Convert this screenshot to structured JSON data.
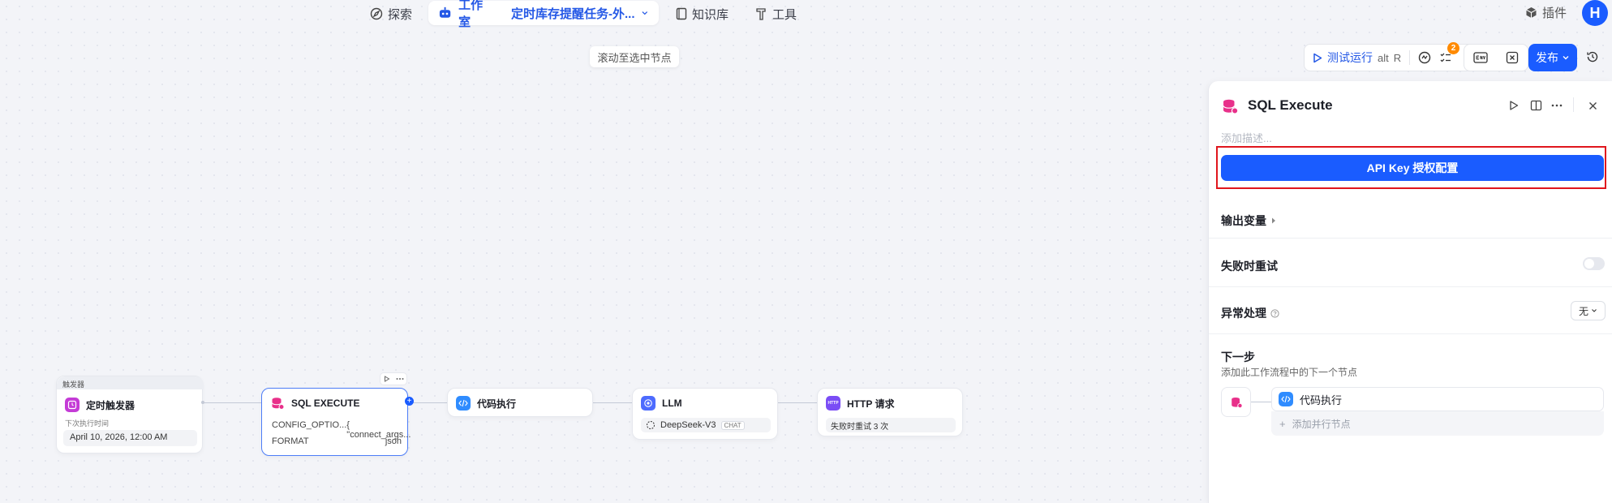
{
  "nav": {
    "explore": "探索",
    "studio": "工作室",
    "workflow_name": "定时库存提醒任务-外...",
    "knowledge": "知识库",
    "tools": "工具",
    "plugins": "插件",
    "avatar": "H"
  },
  "canvas": {
    "scroll_hint": "滚动至选中节点"
  },
  "toolbar": {
    "test_run": "测试运行",
    "shortcut_alt": "alt",
    "shortcut_key": "R",
    "badge_count": "2",
    "publish": "发布"
  },
  "nodes": {
    "trigger_group_label": "触发器",
    "trigger_title": "定时触发器",
    "trigger_next_label": "下次执行时间",
    "trigger_next_value": "April 10, 2026, 12:00 AM",
    "sql_title": "SQL EXECUTE",
    "sql_row1_key": "CONFIG_OPTIO...",
    "sql_row1_val": "{ \"connect_args...",
    "sql_row2_key": "FORMAT",
    "sql_row2_val": "json",
    "code_title": "代码执行",
    "llm_title": "LLM",
    "llm_model": "DeepSeek-V3",
    "llm_tag": "CHAT",
    "http_title": "HTTP 请求",
    "http_retry": "失败时重试 3 次"
  },
  "panel": {
    "title": "SQL Execute",
    "desc_placeholder": "添加描述...",
    "api_key_button": "API Key 授权配置",
    "output_vars": "输出变量",
    "retry_on_fail": "失败时重试",
    "exception": "异常处理",
    "exception_value": "无",
    "next_step": "下一步",
    "next_step_sub": "添加此工作流程中的下一个节点",
    "next_node": "代码执行",
    "add_parallel": "添加并行节点"
  },
  "colors": {
    "accent": "#1a5cff",
    "highlight": "#e0161d",
    "sql_icon": "#e8308a",
    "trigger_icon": "#c43bd6",
    "code_icon": "#2f8cff",
    "llm_icon": "#4d6bfe",
    "http_icon": "#7a4df5"
  }
}
